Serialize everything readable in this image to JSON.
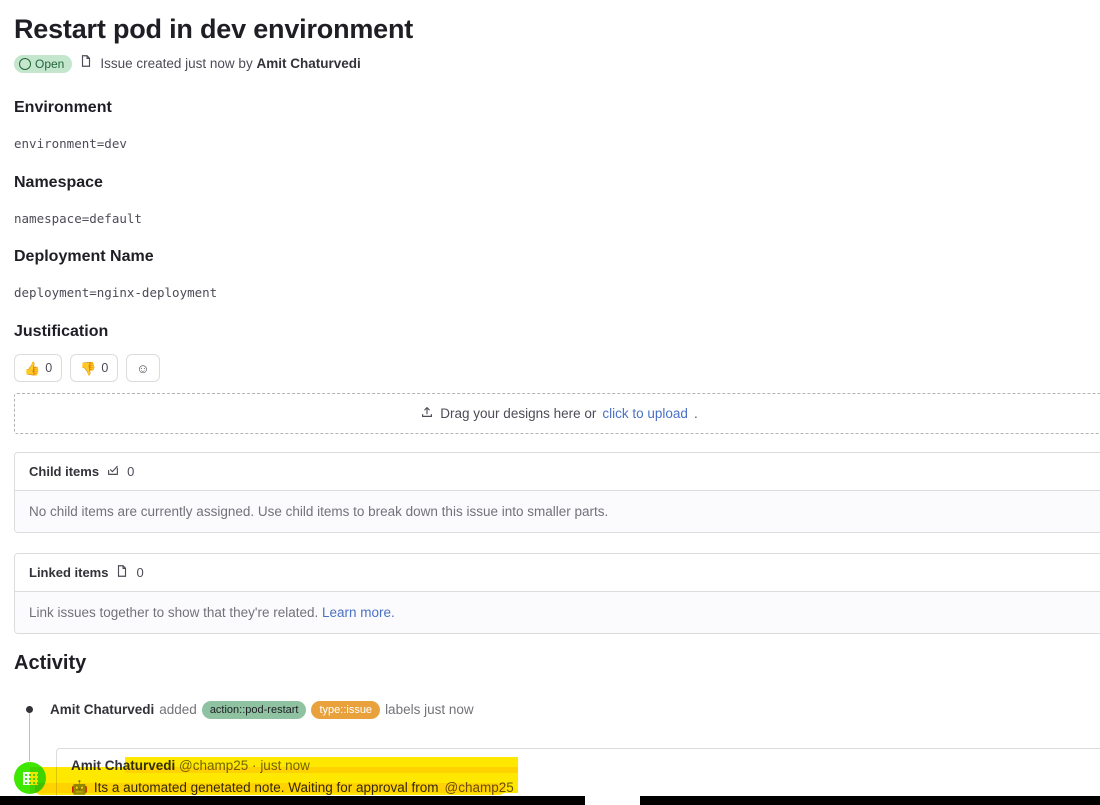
{
  "issue": {
    "title": "Restart pod in dev environment",
    "status_label": "Open",
    "status_color": "#c3e6cd",
    "status_text_color": "#24663b",
    "meta_prefix": "Issue created just now by",
    "author": "Amit Chaturvedi",
    "issue_icon": "issue-icon",
    "status_icon": "open-circle-icon"
  },
  "description": {
    "sections": [
      {
        "heading": "Environment",
        "value": "environment=dev"
      },
      {
        "heading": "Namespace",
        "value": "namespace=default"
      },
      {
        "heading": "Deployment Name",
        "value": "deployment=nginx-deployment"
      },
      {
        "heading": "Justification",
        "value": ""
      }
    ]
  },
  "reactions": [
    {
      "name": "thumbs-up-reaction",
      "emoji": "👍",
      "count": "0"
    },
    {
      "name": "thumbs-down-reaction",
      "emoji": "👎",
      "count": "0"
    }
  ],
  "add_reaction": {
    "icon": "smiley-icon",
    "glyph": "☺"
  },
  "dropzone": {
    "icon": "upload-icon",
    "text": "Drag your designs here or",
    "link": "click to upload",
    "suffix": "."
  },
  "child_items": {
    "title": "Child items",
    "icon": "task-done-icon",
    "count": "0",
    "empty_text": "No child items are currently assigned. Use child items to break down this issue into smaller parts."
  },
  "linked_items": {
    "title": "Linked items",
    "icon": "issue-icon",
    "count": "0",
    "empty_text": "Link issues together to show that they're related.",
    "link": "Learn more."
  },
  "activity": {
    "heading": "Activity",
    "event": {
      "who": "Amit Chaturvedi",
      "verb": "added",
      "labels": [
        {
          "text": "action::pod-restart",
          "bg": "#8ec2a0",
          "fg": "#1f1e24"
        },
        {
          "text": "type::issue",
          "bg": "#e9a13b",
          "fg": "#ffffff"
        }
      ],
      "suffix": "labels just now"
    },
    "comment": {
      "author": "Amit Chaturvedi",
      "handle": "@champ25",
      "separator": "·",
      "time": "just now",
      "emoji": "🤖",
      "body": "Its a automated genetated note. Waiting for approval from",
      "mention": "@champ25",
      "avatar": "user-avatar"
    }
  },
  "annotation": {
    "highlight_color": "#ffe800"
  }
}
